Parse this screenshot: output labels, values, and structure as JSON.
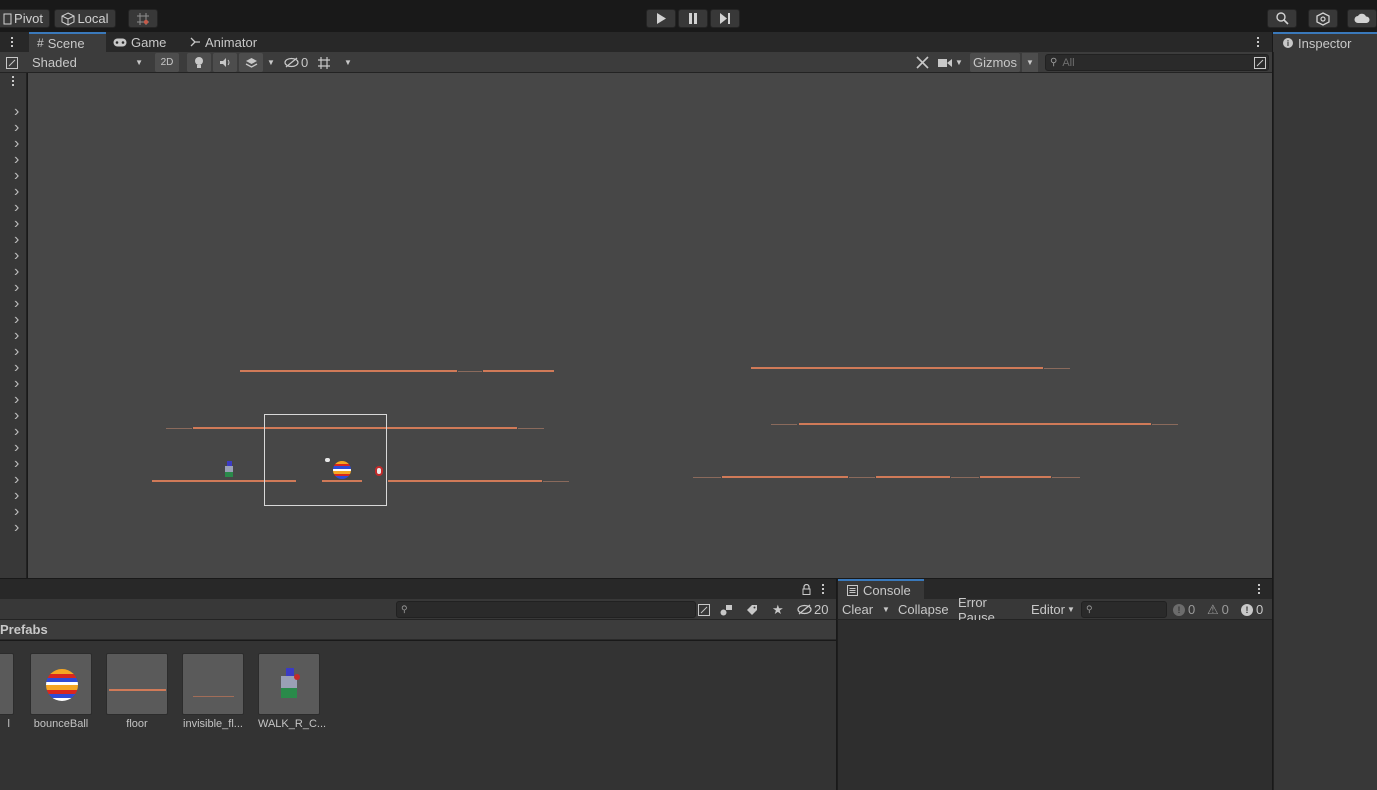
{
  "toolbar": {
    "pivot_label": "Pivot",
    "local_label": "Local",
    "play_icon": "play-icon",
    "pause_icon": "pause-icon",
    "step_icon": "step-icon"
  },
  "scene": {
    "tabs": [
      {
        "label": "Scene",
        "icon": "grid-icon",
        "active": true
      },
      {
        "label": "Game",
        "icon": "gamepad-icon",
        "active": false
      },
      {
        "label": "Animator",
        "icon": "animator-icon",
        "active": false
      }
    ],
    "shading_mode": "Shaded",
    "mode_2d_label": "2D",
    "hidden_count": "0",
    "gizmos_label": "Gizmos",
    "search_placeholder": "All"
  },
  "inspector": {
    "tab_label": "Inspector"
  },
  "project": {
    "visible_count": "20",
    "breadcrumb": "Prefabs",
    "assets": [
      {
        "name": "l"
      },
      {
        "name": "bounceBall"
      },
      {
        "name": "floor"
      },
      {
        "name": "invisible_fl..."
      },
      {
        "name": "WALK_R_C..."
      }
    ]
  },
  "console": {
    "tab_label": "Console",
    "clear_label": "Clear",
    "collapse_label": "Collapse",
    "error_pause_label": "Error Pause",
    "editor_label": "Editor",
    "log_count": "0",
    "warning_count": "0",
    "error_count": "0"
  },
  "colors": {
    "accent": "#3a79bb",
    "platform": "#d07a58",
    "viewport_bg": "#474747"
  }
}
